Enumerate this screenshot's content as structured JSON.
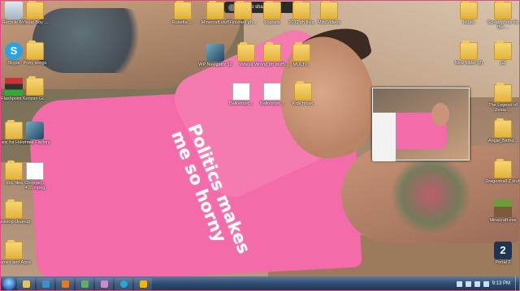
{
  "share_bar": {
    "label": "Stop sharing"
  },
  "wallpaper": {
    "shirt_text": [
      "Politics makes",
      "me so horny"
    ]
  },
  "desktop_icons": [
    {
      "name": "recycle-bin",
      "label": "Recycle Bin",
      "icon": "bin"
    },
    {
      "name": "folder-1",
      "label": "Visual Boy ...",
      "icon": "folder"
    },
    {
      "name": "skype",
      "label": "Skype",
      "icon": "skype"
    },
    {
      "name": "folder-pony-songs",
      "label": "Pony songs",
      "icon": "folder"
    },
    {
      "name": "folder-kenyan",
      "label": "Kenyan Gl...",
      "icon": "folder"
    },
    {
      "name": "flag-app",
      "label": "Flashpoint ...",
      "icon": "flag"
    },
    {
      "name": "folder-music-heather",
      "label": "Music for Heather",
      "icon": "folder"
    },
    {
      "name": "format-factory",
      "label": "Format Factory",
      "icon": "app"
    },
    {
      "name": "folder-docs",
      "label": ".doc files",
      "icon": "folder"
    },
    {
      "name": "chopper-file",
      "label": "Chopper...\n4.....mpeg",
      "icon": "doc"
    },
    {
      "name": "folder-desktop-cleanup",
      "label": "Desktop cleanup",
      "icon": "folder"
    },
    {
      "name": "folder-games-apps",
      "label": "Games and Apps",
      "icon": "folder"
    },
    {
      "name": "folder-rosetta",
      "label": "Rosetta ....",
      "icon": "folder"
    },
    {
      "name": "folder-minecraft-stuff",
      "label": "Minecraft stuff",
      "icon": "folder"
    },
    {
      "name": "folder-finished",
      "label": "Finished ph...",
      "icon": "folder"
    },
    {
      "name": "folder-logos",
      "label": "Logosts",
      "icon": "folder"
    },
    {
      "name": "folder-2011",
      "label": "2011 ph files",
      "icon": "folder"
    },
    {
      "name": "folder-miscvideos",
      "label": "MiscVideos",
      "icon": "folder"
    },
    {
      "name": "wp-navigator",
      "label": "WP Navigator 12",
      "icon": "app"
    },
    {
      "name": "folder-videos",
      "label": "Videos",
      "icon": "folder"
    },
    {
      "name": "folder-wrong",
      "label": "Wrong (m stuff) ...",
      "icon": "folder"
    },
    {
      "name": "folder-multi",
      "label": "MULTI...",
      "icon": "folder"
    },
    {
      "name": "doc-balloons1",
      "label": "Balloonpic...",
      "icon": "doc"
    },
    {
      "name": "doc-balloons2",
      "label": "Balloonpic...",
      "icon": "doc"
    },
    {
      "name": "folder-kids-music",
      "label": "Kids music",
      "icon": "folder"
    },
    {
      "name": "folder-music",
      "label": "Music",
      "icon": "folder"
    },
    {
      "name": "folder-screenshots",
      "label": "Screenshots for the ...",
      "icon": "folder"
    },
    {
      "name": "folder-new",
      "label": "New folder (2)",
      "icon": "folder"
    },
    {
      "name": "folder-p2",
      "label": "p2",
      "icon": "folder"
    },
    {
      "name": "folder-legend",
      "label": "The Legend of Zelda ...",
      "icon": "folder"
    },
    {
      "name": "folder-angie",
      "label": "Angie_Birthd...",
      "icon": "folder"
    },
    {
      "name": "folder-dragonball",
      "label": "Dragonball Z stuff",
      "icon": "folder"
    },
    {
      "name": "minecraft",
      "label": "Minecraft.exe",
      "icon": "mc"
    },
    {
      "name": "portal2",
      "label": "Portal 2",
      "icon": "portal"
    }
  ],
  "taskbar": {
    "clock": "9:13 PM"
  }
}
